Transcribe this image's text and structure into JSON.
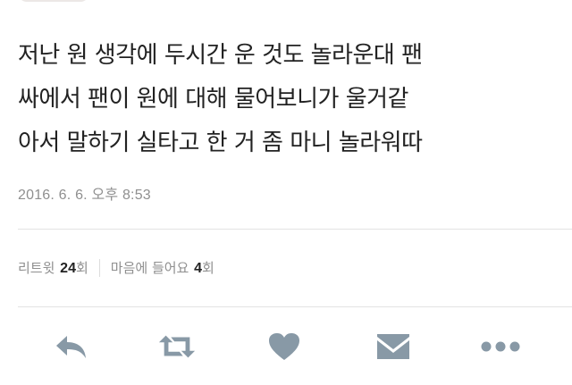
{
  "tweet": {
    "text_lines": [
      "저난 원 생각에 두시간 운 것도 놀라운대 팬",
      "싸에서 팬이 원에 대해 물어보니가 울거같",
      "아서 말하기 실타고 한 거 좀 마니 놀라워따"
    ],
    "timestamp": "2016. 6. 6. 오후 8:53"
  },
  "stats": {
    "retweets_label_prefix": "리트윗 ",
    "retweets_count": "24",
    "retweets_label_suffix": "회",
    "likes_label_prefix": "마음에 들어요 ",
    "likes_count": "4",
    "likes_label_suffix": "회"
  },
  "actions": {
    "reply_icon": "reply-icon",
    "retweet_icon": "retweet-icon",
    "like_icon": "heart-icon",
    "dm_icon": "envelope-icon",
    "more_icon": "more-dots-icon",
    "icon_color": "#8899a6"
  }
}
